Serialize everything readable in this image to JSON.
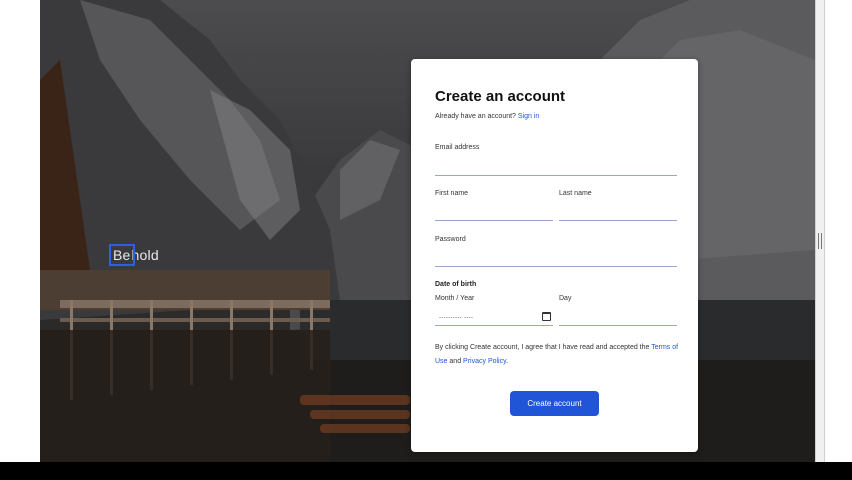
{
  "hero": {
    "overlay_text_selected": "Be",
    "overlay_text_rest": "hold"
  },
  "form": {
    "title": "Create an account",
    "signin_prompt": "Already have an account?",
    "signin_link": "Sign in",
    "email_label": "Email address",
    "email_value": "",
    "first_name_label": "First name",
    "first_name_value": "",
    "last_name_label": "Last name",
    "last_name_value": "",
    "password_label": "Password",
    "password_value": "",
    "dob_heading": "Date of birth",
    "month_year_label": "Month / Year",
    "month_year_placeholder": "---------- ----",
    "day_label": "Day",
    "day_value": "",
    "terms_prefix": "By clicking Create account, I agree that I have read and accepted the",
    "terms_link": "Terms of Use",
    "terms_and": "and",
    "privacy_link": "Privacy Policy",
    "terms_suffix": ".",
    "submit_label": "Create account"
  },
  "colors": {
    "accent": "#1f55d6",
    "selection_outline": "#2f5de6",
    "field_underline": "#9aa6c9"
  }
}
